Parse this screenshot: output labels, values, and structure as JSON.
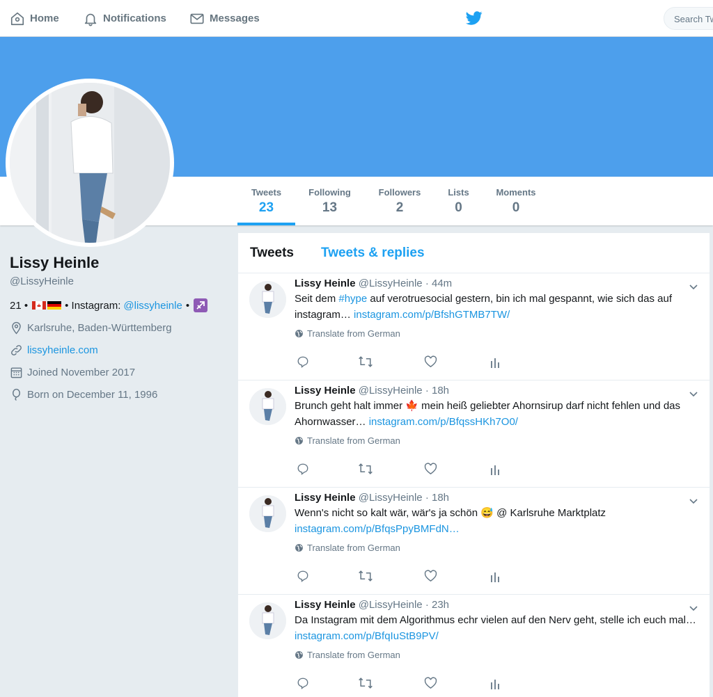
{
  "nav": {
    "home": "Home",
    "notifications": "Notifications",
    "messages": "Messages",
    "search_placeholder": "Search Twitter"
  },
  "stats": [
    {
      "label": "Tweets",
      "value": "23"
    },
    {
      "label": "Following",
      "value": "13"
    },
    {
      "label": "Followers",
      "value": "2"
    },
    {
      "label": "Lists",
      "value": "0"
    },
    {
      "label": "Moments",
      "value": "0"
    }
  ],
  "profile": {
    "name": "Lissy Heinle",
    "handle": "@LissyHeinle",
    "bio_age": "21 •",
    "bio_mid": "• Instagram:",
    "bio_instagram": "@lissyheinle",
    "bio_sep": "•",
    "location": "Karlsruhe, Baden-Württemberg",
    "website": "lissyheinle.com",
    "joined": "Joined November 2017",
    "born": "Born on December 11, 1996"
  },
  "timeline": {
    "tab_tweets": "Tweets",
    "tab_replies": "Tweets & replies",
    "translate_label": "Translate from German",
    "tweets": [
      {
        "name": "Lissy Heinle",
        "handle": "@LissyHeinle",
        "time": "· 44m",
        "text_before": "Seit dem ",
        "hashtag": "#hype",
        "text_after": " auf verotruesocial gestern, bin ich mal gespannt, wie sich das auf instagram… ",
        "link": "instagram.com/p/BfshGTMB7TW/"
      },
      {
        "name": "Lissy Heinle",
        "handle": "@LissyHeinle",
        "time": "· 18h",
        "text_before": "Brunch geht halt immer ",
        "emoji": "🍁",
        "text_after": " mein heiß geliebter Ahornsirup darf nicht fehlen und das Ahornwasser… ",
        "link": "instagram.com/p/BfqssHKh7O0/"
      },
      {
        "name": "Lissy Heinle",
        "handle": "@LissyHeinle",
        "time": "· 18h",
        "text_before": "Wenn's nicht so kalt wär, wär's ja schön ",
        "emoji": "😅",
        "text_after": " @ Karlsruhe Marktplatz ",
        "link": "instagram.com/p/BfqsPpyBMFdN…"
      },
      {
        "name": "Lissy Heinle",
        "handle": "@LissyHeinle",
        "time": "· 23h",
        "text_before": "Da Instagram mit dem Algorithmus echr vielen auf den Nerv geht, stelle ich euch mal… ",
        "link": "instagram.com/p/BfqIuStB9PV/"
      }
    ]
  },
  "colors": {
    "banner": "#4d9fec",
    "accent": "#1da1f2",
    "link": "#1b95e0"
  }
}
